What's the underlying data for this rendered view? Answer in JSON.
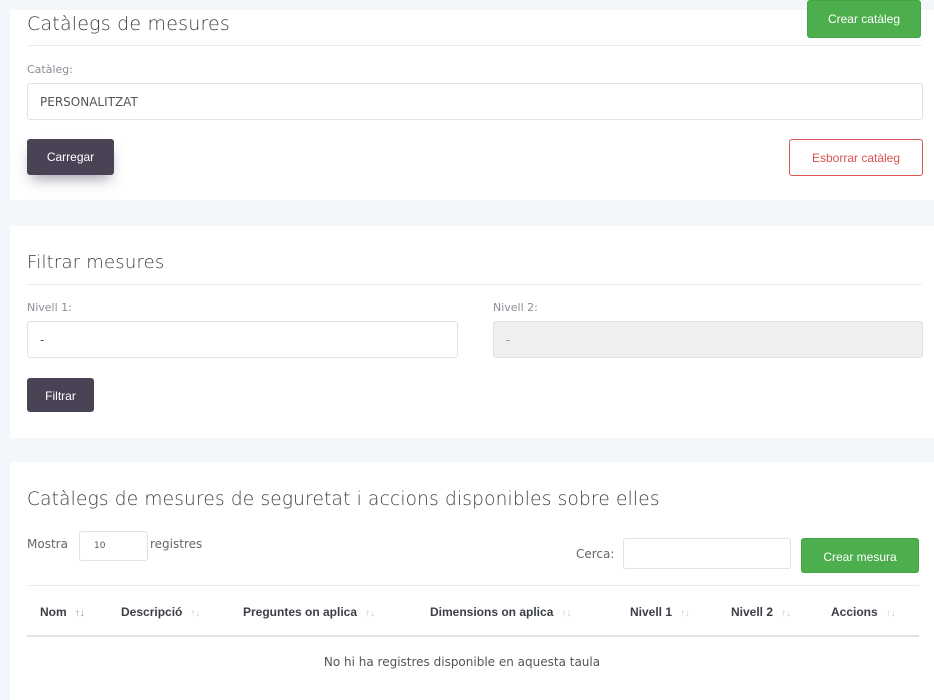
{
  "catalog_panel": {
    "title": "Catàlegs de mesures",
    "create_catalog_button": "Crear catàleg",
    "catalog_label": "Catàleg:",
    "catalog_value": "PERSONALITZAT",
    "load_button": "Carregar",
    "delete_catalog_button": "Esborrar catàleg"
  },
  "filter_panel": {
    "title": "Filtrar mesures",
    "level1_label": "Nivell 1:",
    "level1_value": "-",
    "level2_label": "Nivell 2:",
    "level2_value": "-",
    "filter_button": "Filtrar"
  },
  "table_panel": {
    "title": "Catàlegs de mesures de seguretat i accions disponibles sobre elles",
    "show_label": "Mostra",
    "page_size": "10",
    "records_label": "registres",
    "search_label": "Cerca:",
    "search_value": "",
    "create_measure_button": "Crear mesura",
    "columns": [
      "Nom",
      "Descripció",
      "Preguntes on aplica",
      "Dimensions on aplica",
      "Nivell 1",
      "Nivell 2",
      "Accions"
    ],
    "sort_icon": "↑↓",
    "empty_message": "No hi ha registres disponible en aquesta taula"
  },
  "colors": {
    "page_background": "#f3f6fb",
    "dark_button": "#4a4356",
    "green_button": "#4cae4c",
    "danger": "#d9534f"
  }
}
